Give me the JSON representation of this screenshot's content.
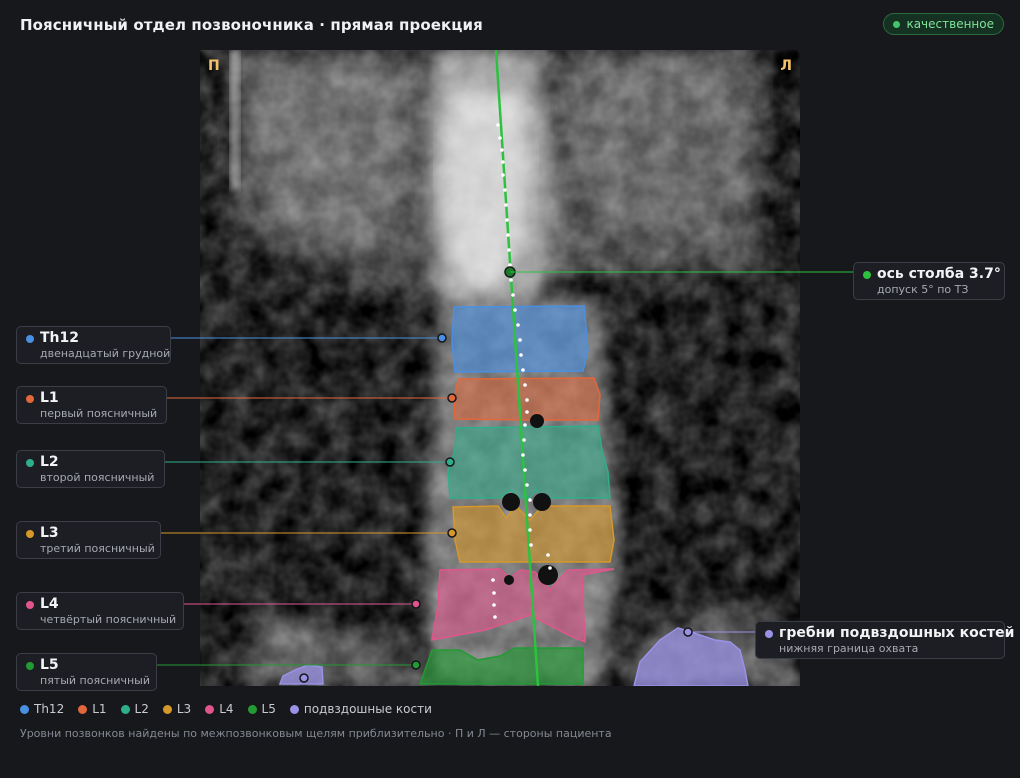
{
  "header": {
    "title": "Поясничный отдел позвоночника · прямая проекция",
    "quality_badge": "качественное"
  },
  "viewer": {
    "side_left": "П",
    "side_right": "Л"
  },
  "labels": {
    "th12": {
      "name": "Th12",
      "sub": "двенадцатый грудной",
      "color": "#4a90e2"
    },
    "l1": {
      "name": "L1",
      "sub": "первый поясничный",
      "color": "#e2673a"
    },
    "l2": {
      "name": "L2",
      "sub": "второй поясничный",
      "color": "#2fae8a"
    },
    "l3": {
      "name": "L3",
      "sub": "третий поясничный",
      "color": "#d6982a"
    },
    "l4": {
      "name": "L4",
      "sub": "четвёртый поясничный",
      "color": "#e0568c"
    },
    "l5": {
      "name": "L5",
      "sub": "пятый поясничный",
      "color": "#239a34"
    },
    "axis": {
      "name": "ось столба 3.7°",
      "sub": "допуск 5° по ТЗ",
      "color": "#2cc23f"
    },
    "iliac": {
      "name": "гребни подвздошных костей",
      "sub": "нижняя граница охвата",
      "color": "#9a92e6"
    }
  },
  "legend": [
    {
      "label": "Th12",
      "color": "#4a90e2"
    },
    {
      "label": "L1",
      "color": "#e2673a"
    },
    {
      "label": "L2",
      "color": "#2fae8a"
    },
    {
      "label": "L3",
      "color": "#d6982a"
    },
    {
      "label": "L4",
      "color": "#e0568c"
    },
    {
      "label": "L5",
      "color": "#239a34"
    },
    {
      "label": "подвздошные кости",
      "color": "#9a92e6"
    }
  ],
  "footnote": "Уровни позвонков найдены по межпозвонковым щелям приблизительно · П и Л — стороны пациента"
}
